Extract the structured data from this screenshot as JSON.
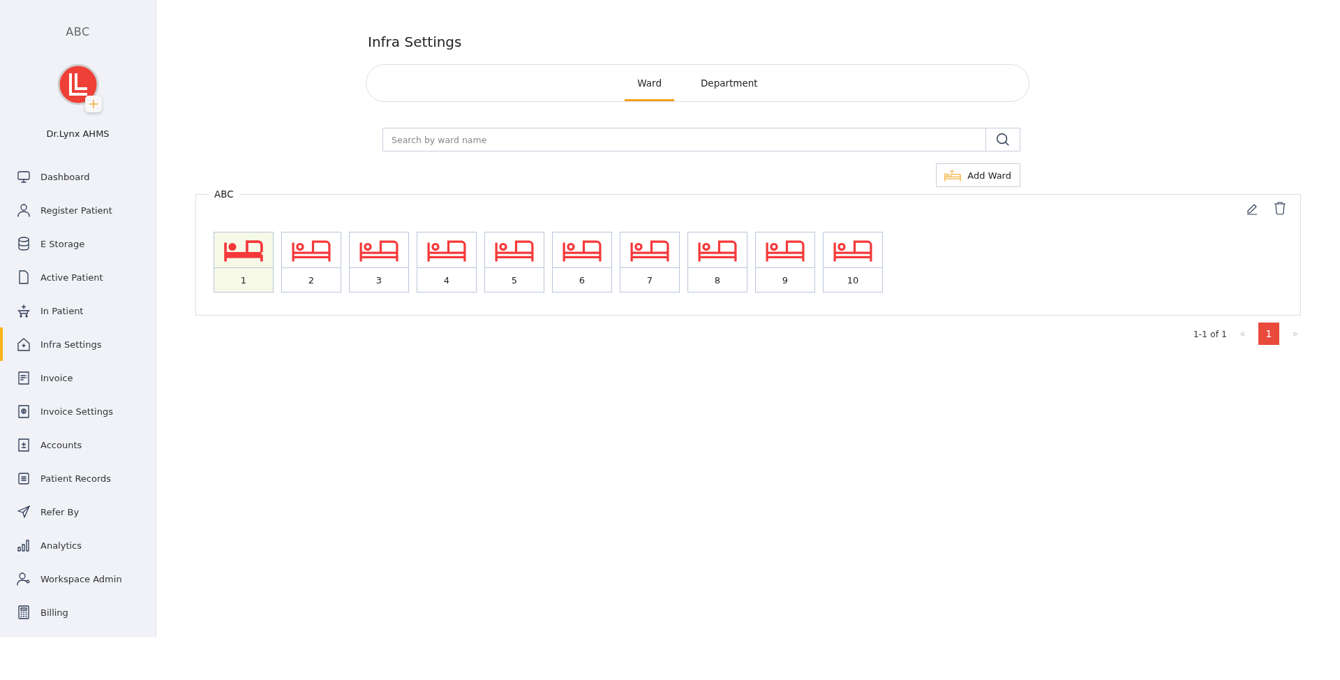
{
  "sidebar": {
    "org": "ABC",
    "user": "Dr.Lynx AHMS",
    "items": [
      {
        "label": "Dashboard",
        "selected": false
      },
      {
        "label": "Register Patient",
        "selected": false
      },
      {
        "label": "E Storage",
        "selected": false
      },
      {
        "label": "Active Patient",
        "selected": false
      },
      {
        "label": "In Patient",
        "selected": false
      },
      {
        "label": "Infra Settings",
        "selected": true
      },
      {
        "label": "Invoice",
        "selected": false
      },
      {
        "label": "Invoice Settings",
        "selected": false
      },
      {
        "label": "Accounts",
        "selected": false
      },
      {
        "label": "Patient Records",
        "selected": false
      },
      {
        "label": "Refer By",
        "selected": false
      },
      {
        "label": "Analytics",
        "selected": false
      },
      {
        "label": "Workspace Admin",
        "selected": false
      },
      {
        "label": "Billing",
        "selected": false
      }
    ]
  },
  "page": {
    "title": "Infra Settings"
  },
  "tabs": [
    {
      "label": "Ward",
      "selected": true
    },
    {
      "label": "Department",
      "selected": false
    }
  ],
  "search": {
    "placeholder": "Search by ward name"
  },
  "add_button": "Add Ward",
  "ward": {
    "name": "ABC",
    "beds": [
      {
        "number": "1",
        "occupied": true
      },
      {
        "number": "2",
        "occupied": false
      },
      {
        "number": "3",
        "occupied": false
      },
      {
        "number": "4",
        "occupied": false
      },
      {
        "number": "5",
        "occupied": false
      },
      {
        "number": "6",
        "occupied": false
      },
      {
        "number": "7",
        "occupied": false
      },
      {
        "number": "8",
        "occupied": false
      },
      {
        "number": "9",
        "occupied": false
      },
      {
        "number": "10",
        "occupied": false
      }
    ]
  },
  "pagination": {
    "range": "1-1 of 1",
    "pages": [
      {
        "label": "1",
        "selected": true
      }
    ]
  }
}
